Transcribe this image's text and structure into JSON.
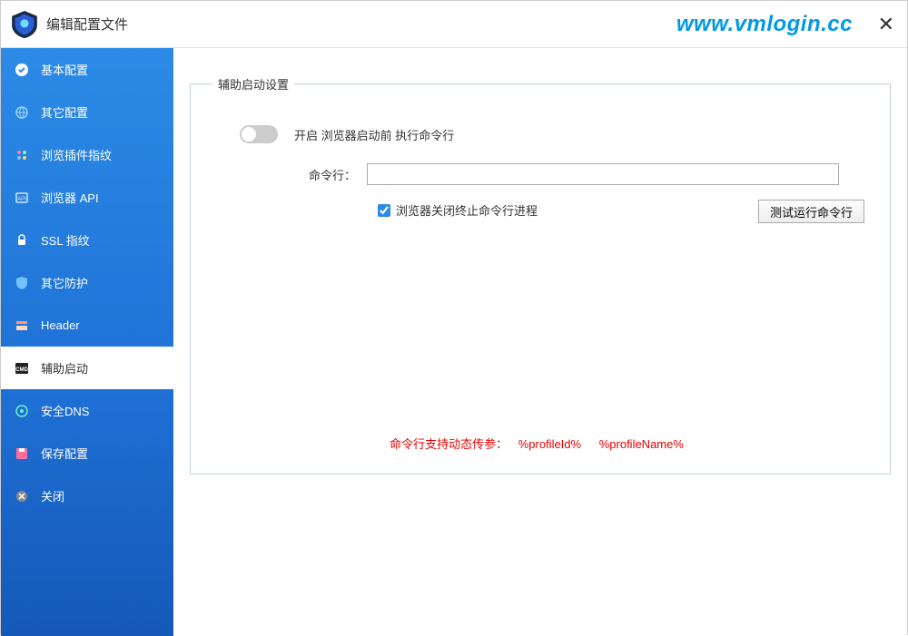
{
  "titlebar": {
    "title": "编辑配置文件",
    "watermark": "www.vmlogin.cc"
  },
  "sidebar": {
    "items": [
      {
        "label": "基本配置"
      },
      {
        "label": "其它配置"
      },
      {
        "label": "浏览插件指纹"
      },
      {
        "label": "浏览器 API"
      },
      {
        "label": "SSL 指纹"
      },
      {
        "label": "其它防护"
      },
      {
        "label": "Header"
      },
      {
        "label": "辅助启动"
      },
      {
        "label": "安全DNS"
      },
      {
        "label": "保存配置"
      },
      {
        "label": "关闭"
      }
    ],
    "active_index": 7
  },
  "panel": {
    "legend": "辅助启动设置",
    "toggle_label": "开启 浏览器启动前 执行命令行",
    "cmd_label": "命令行：",
    "cmd_value": "",
    "terminate_label": "浏览器关闭终止命令行进程",
    "terminate_checked": true,
    "test_button": "测试运行命令行",
    "hint_prefix": "命令行支持动态传参：",
    "hint_p1": "%profileId%",
    "hint_p2": "%profileName%"
  }
}
